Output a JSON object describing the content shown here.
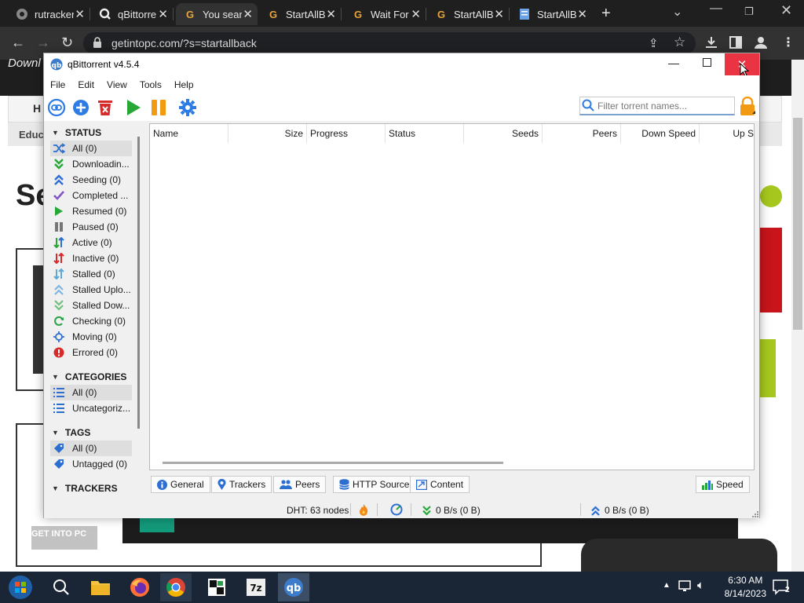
{
  "browser": {
    "tabs": [
      {
        "title": "rutracker",
        "icon": "chrome-default-icon"
      },
      {
        "title": "qBittorrent",
        "icon": "qbittorrent-search-icon"
      },
      {
        "title": "You searched",
        "icon": "g-favicon-icon"
      },
      {
        "title": "StartAllBack",
        "icon": "g-favicon-icon"
      },
      {
        "title": "Wait For",
        "icon": "g-favicon-icon"
      },
      {
        "title": "StartAllBack",
        "icon": "g-favicon-icon"
      },
      {
        "title": "StartAllBack",
        "icon": "doc-favicon-icon"
      }
    ],
    "url": "getintopc.com/?s=startallback"
  },
  "website": {
    "header_fragment": "Downl",
    "nav_fragment": "H",
    "category_fragment": "Educ",
    "heading_fragment": "Se",
    "watermark": "GET INTO PC",
    "accent_colors": {
      "red": "#c8141a",
      "green": "#a6c81e",
      "dark": "#1c1c1c"
    }
  },
  "qbittorrent": {
    "title": "qBittorrent v4.5.4",
    "menu": [
      "File",
      "Edit",
      "View",
      "Tools",
      "Help"
    ],
    "filter_placeholder": "Filter torrent names...",
    "sections": {
      "status": "STATUS",
      "categories": "CATEGORIES",
      "tags": "TAGS",
      "trackers": "TRACKERS"
    },
    "status_filters": [
      {
        "label": "All (0)",
        "icon": "shuffle-icon"
      },
      {
        "label": "Downloadin...",
        "icon": "download-arrows-icon"
      },
      {
        "label": "Seeding (0)",
        "icon": "upload-arrows-icon"
      },
      {
        "label": "Completed ...",
        "icon": "checkmark-icon"
      },
      {
        "label": "Resumed (0)",
        "icon": "play-icon"
      },
      {
        "label": "Paused (0)",
        "icon": "pause-icon"
      },
      {
        "label": "Active (0)",
        "icon": "active-arrows-icon"
      },
      {
        "label": "Inactive (0)",
        "icon": "inactive-arrows-icon"
      },
      {
        "label": "Stalled (0)",
        "icon": "stalled-arrows-icon"
      },
      {
        "label": "Stalled Uplo...",
        "icon": "stalled-upload-icon"
      },
      {
        "label": "Stalled Dow...",
        "icon": "stalled-download-icon"
      },
      {
        "label": "Checking (0)",
        "icon": "refresh-icon"
      },
      {
        "label": "Moving (0)",
        "icon": "move-icon"
      },
      {
        "label": "Errored (0)",
        "icon": "error-icon"
      }
    ],
    "category_filters": [
      {
        "label": "All (0)",
        "icon": "list-icon"
      },
      {
        "label": "Uncategoriz...",
        "icon": "list-icon"
      }
    ],
    "tag_filters": [
      {
        "label": "All (0)",
        "icon": "tag-icon"
      },
      {
        "label": "Untagged (0)",
        "icon": "tag-icon"
      }
    ],
    "columns": [
      "Name",
      "Size",
      "Progress",
      "Status",
      "Seeds",
      "Peers",
      "Down Speed",
      "Up S"
    ],
    "bottom_tabs": [
      "General",
      "Trackers",
      "Peers",
      "HTTP Sources",
      "Content"
    ],
    "speed_tab": "Speed",
    "statusbar": {
      "dht": "DHT: 63 nodes",
      "down": "0 B/s (0 B)",
      "up": "0 B/s (0 B)"
    }
  },
  "taskbar": {
    "time": "6:30 AM",
    "date": "8/14/2023",
    "notifications": "2"
  }
}
